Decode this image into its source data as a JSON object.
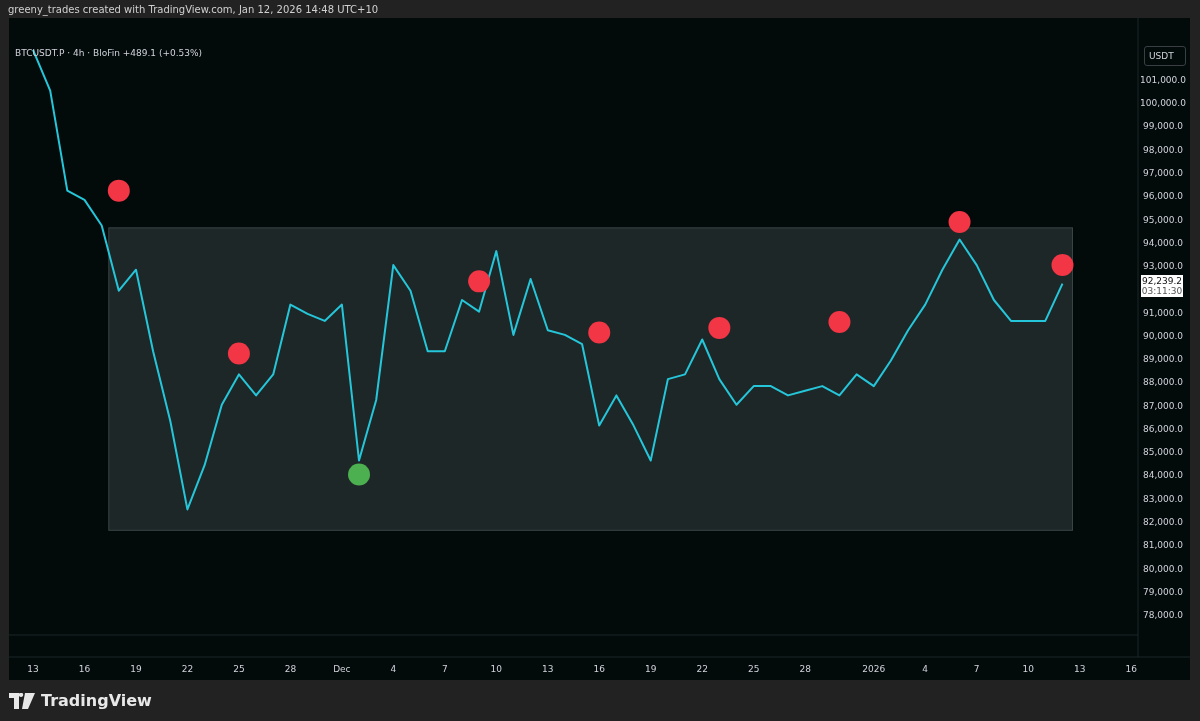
{
  "header": {
    "text": "greeny_trades created with TradingView.com, Jan 12, 2026 14:48 UTC+10"
  },
  "chart": {
    "legend": "· 4h · BloFin  +489.1 (+0.53%)",
    "currency_button": "USDT",
    "last_price": {
      "price": "92,239.2",
      "countdown": "03:11:30"
    },
    "chart_data": {
      "type": "line",
      "categories": [
        "13",
        null,
        null,
        "16",
        null,
        null,
        "19",
        null,
        null,
        "22",
        null,
        null,
        "25",
        null,
        null,
        "28",
        null,
        null,
        "Dec",
        null,
        null,
        "4",
        null,
        null,
        "7",
        null,
        null,
        "10",
        null,
        null,
        "13",
        null,
        null,
        "16",
        null,
        null,
        "19",
        null,
        null,
        "22",
        null,
        null,
        "25",
        null,
        null,
        "28",
        null,
        null,
        null,
        "2026",
        null,
        null,
        "4",
        null,
        null,
        "7",
        null,
        null,
        "10",
        null,
        null,
        "13",
        null,
        null,
        "16"
      ],
      "series": [
        {
          "name": "BTCUSDT.P",
          "color": "#26c6da",
          "values": [
            102250,
            100500,
            96200,
            95800,
            94700,
            91900,
            92800,
            89300,
            86300,
            82500,
            84400,
            87000,
            88300,
            87400,
            88300,
            91300,
            90900,
            90600,
            91300,
            84600,
            87200,
            93000,
            91900,
            89300,
            89300,
            91500,
            91000,
            93600,
            90000,
            92400,
            90200,
            90000,
            89600,
            86100,
            87400,
            86100,
            84600,
            88100,
            88300,
            89800,
            88100,
            87000,
            87800,
            87800,
            87400,
            87600,
            87800,
            87400,
            88300,
            87800,
            88900,
            90200,
            91300,
            92800,
            94100,
            93000,
            91500,
            90600,
            90600,
            90600,
            92200,
            null,
            null,
            null,
            null
          ]
        },
        {
          "type": "scatter",
          "color": "#f23645",
          "values": [
            null,
            null,
            null,
            null,
            null,
            96200,
            null,
            null,
            null,
            null,
            null,
            null,
            89200,
            null,
            null,
            null,
            null,
            null,
            null,
            null,
            null,
            null,
            null,
            null,
            null,
            null,
            92300,
            null,
            null,
            null,
            null,
            null,
            null,
            90100,
            null,
            null,
            null,
            null,
            null,
            null,
            90300,
            null,
            null,
            null,
            null,
            null,
            null,
            90550,
            null,
            null,
            null,
            null,
            null,
            null,
            94850,
            null,
            null,
            null,
            null,
            null,
            93000,
            null,
            null,
            null,
            null
          ]
        },
        {
          "type": "scatter",
          "color": "#4caf50",
          "values": [
            null,
            null,
            null,
            null,
            null,
            null,
            null,
            null,
            null,
            null,
            null,
            null,
            null,
            null,
            null,
            null,
            null,
            null,
            null,
            84000,
            null,
            null,
            null,
            null,
            null,
            null,
            null,
            null,
            null,
            null,
            null,
            null,
            null,
            null,
            null,
            null,
            null,
            null,
            null,
            null,
            null,
            null,
            null,
            null,
            null,
            null,
            null,
            null,
            null,
            null,
            null,
            null,
            null,
            null,
            null,
            null,
            null,
            null,
            null,
            null,
            null,
            null,
            null,
            null,
            null
          ]
        }
      ],
      "ylim": [
        77100,
        103620
      ],
      "yticks": [
        {
          "value": 101000,
          "label": "101,000.0"
        },
        {
          "value": 100000,
          "label": "100,000.0"
        },
        {
          "value": 99000,
          "label": "99,000.0"
        },
        {
          "value": 98000,
          "label": "98,000.0"
        },
        {
          "value": 97000,
          "label": "97,000.0"
        },
        {
          "value": 96000,
          "label": "96,000.0"
        },
        {
          "value": 95000,
          "label": "95,000.0"
        },
        {
          "value": 94000,
          "label": "94,000.0"
        },
        {
          "value": 93000,
          "label": "93,000.0"
        },
        {
          "value": 91000,
          "label": "91,000.0"
        },
        {
          "value": 90000,
          "label": "90,000.0"
        },
        {
          "value": 89000,
          "label": "89,000.0"
        },
        {
          "value": 88000,
          "label": "88,000.0"
        },
        {
          "value": 87000,
          "label": "87,000.0"
        },
        {
          "value": 86000,
          "label": "86,000.0"
        },
        {
          "value": 85000,
          "label": "85,000.0"
        },
        {
          "value": 84000,
          "label": "84,000.0"
        },
        {
          "value": 83000,
          "label": "83,000.0"
        },
        {
          "value": 82000,
          "label": "82,000.0"
        },
        {
          "value": 81000,
          "label": "81,000.0"
        },
        {
          "value": 80000,
          "label": "80,000.0"
        },
        {
          "value": 79000,
          "label": "79,000.0"
        },
        {
          "value": 78000,
          "label": "78,000.0"
        }
      ],
      "bands": [
        {
          "axis": "y",
          "from": 81600,
          "to": 94600
        }
      ]
    }
  },
  "footer": {
    "logo": "TradingView"
  }
}
